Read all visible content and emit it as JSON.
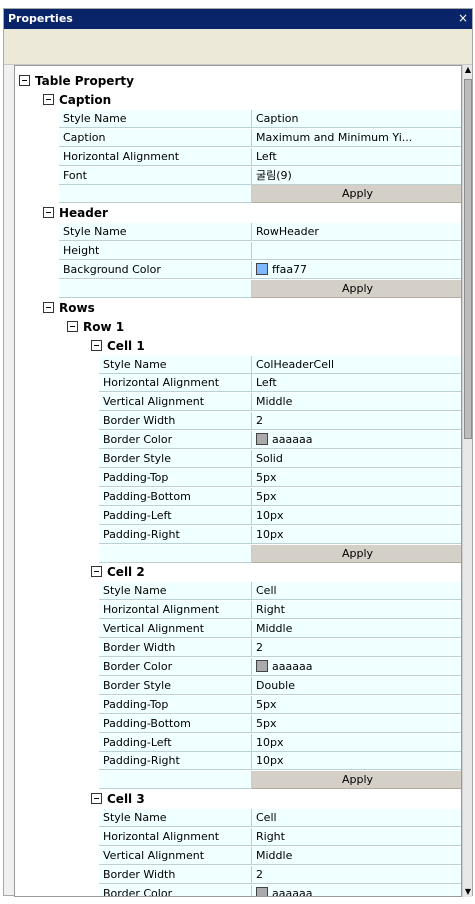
{
  "window": {
    "title": "Properties",
    "close_glyph": "×"
  },
  "tree": {
    "table_property": "Table Property",
    "caption_section": {
      "label": "Caption",
      "rows": [
        {
          "name": "Style Name",
          "value": "Caption"
        },
        {
          "name": "Caption",
          "value": "Maximum and Minimum Yi..."
        },
        {
          "name": "Horizontal Alignment",
          "value": "Left"
        },
        {
          "name": "Font",
          "value": "굴림(9)"
        }
      ],
      "apply": "Apply"
    },
    "header_section": {
      "label": "Header",
      "rows": [
        {
          "name": "Style Name",
          "value": "RowHeader"
        },
        {
          "name": "Height",
          "value": ""
        },
        {
          "name": "Background Color",
          "value": "ffaa77",
          "swatch": "#7fb8ff"
        }
      ],
      "apply": "Apply"
    },
    "rows_section": {
      "label": "Rows",
      "row1": "Row 1",
      "cell1": {
        "label": "Cell 1",
        "rows": [
          {
            "name": "Style Name",
            "value": "ColHeaderCell"
          },
          {
            "name": "Horizontal Alignment",
            "value": "Left"
          },
          {
            "name": "Vertical Alignment",
            "value": "Middle"
          },
          {
            "name": "Border Width",
            "value": "2"
          },
          {
            "name": "Border Color",
            "value": "aaaaaa",
            "swatch": "#aaaaaa"
          },
          {
            "name": "Border Style",
            "value": "Solid"
          },
          {
            "name": "Padding-Top",
            "value": "5px"
          },
          {
            "name": "Padding-Bottom",
            "value": "5px"
          },
          {
            "name": "Padding-Left",
            "value": "10px"
          },
          {
            "name": "Padding-Right",
            "value": "10px"
          }
        ],
        "apply": "Apply"
      },
      "cell2": {
        "label": "Cell 2",
        "rows": [
          {
            "name": "Style Name",
            "value": "Cell"
          },
          {
            "name": "Horizontal Alignment",
            "value": "Right"
          },
          {
            "name": "Vertical Alignment",
            "value": "Middle"
          },
          {
            "name": "Border Width",
            "value": "2"
          },
          {
            "name": "Border Color",
            "value": "aaaaaa",
            "swatch": "#aaaaaa"
          },
          {
            "name": "Border Style",
            "value": "Double"
          },
          {
            "name": "Padding-Top",
            "value": "5px"
          },
          {
            "name": "Padding-Bottom",
            "value": "5px"
          },
          {
            "name": "Padding-Left",
            "value": "10px"
          },
          {
            "name": "Padding-Right",
            "value": "10px"
          }
        ],
        "apply": "Apply"
      },
      "cell3": {
        "label": "Cell 3",
        "rows": [
          {
            "name": "Style Name",
            "value": "Cell"
          },
          {
            "name": "Horizontal Alignment",
            "value": "Right"
          },
          {
            "name": "Vertical Alignment",
            "value": "Middle"
          },
          {
            "name": "Border Width",
            "value": "2"
          },
          {
            "name": "Border Color",
            "value": "aaaaaa",
            "swatch": "#aaaaaa"
          }
        ]
      }
    }
  },
  "scrollbar": {
    "up_glyph": "▲",
    "down_glyph": "▼"
  }
}
